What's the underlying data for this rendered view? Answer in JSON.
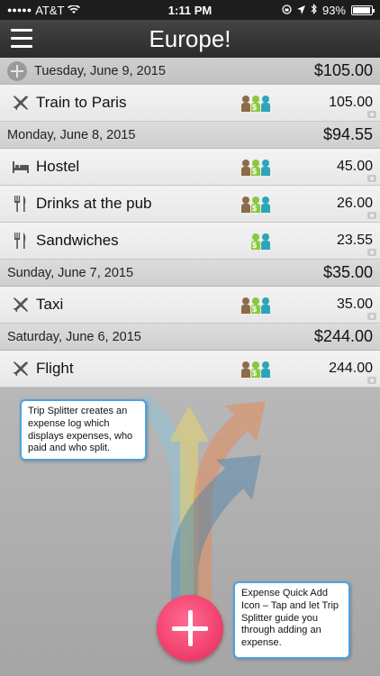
{
  "status": {
    "carrier": "AT&T",
    "time": "1:11 PM",
    "battery": "93%",
    "battery_level": 0.93
  },
  "nav": {
    "title": "Europe!"
  },
  "days": [
    {
      "date": "Tuesday, June 9, 2015",
      "total": "$105.00",
      "expenses": [
        {
          "name": "Train to Paris",
          "amount": "105.00",
          "icon": "airplane-icon"
        }
      ]
    },
    {
      "date": "Monday, June 8, 2015",
      "total": "$94.55",
      "expenses": [
        {
          "name": "Hostel",
          "amount": "45.00",
          "icon": "bed-icon"
        },
        {
          "name": "Drinks at the pub",
          "amount": "26.00",
          "icon": "fork-knife-icon"
        },
        {
          "name": "Sandwiches",
          "amount": "23.55",
          "icon": "fork-knife-icon"
        }
      ]
    },
    {
      "date": "Sunday, June 7, 2015",
      "total": "$35.00",
      "expenses": [
        {
          "name": "Taxi",
          "amount": "35.00",
          "icon": "airplane-icon"
        }
      ]
    },
    {
      "date": "Saturday, June 6, 2015",
      "total": "$244.00",
      "expenses": [
        {
          "name": "Flight",
          "amount": "244.00",
          "icon": "airplane-icon"
        }
      ]
    }
  ],
  "callouts": {
    "log": "Trip Splitter creates an expense log which displays expenses, who paid and who split.",
    "quick_add": "Expense Quick Add Icon – Tap and let Trip Splitter guide you through adding an expense."
  },
  "colors": {
    "person_brown": "#8b6b4a",
    "person_green": "#8cc63f",
    "person_teal": "#2aa6b8",
    "accent_pink": "#f2426f",
    "callout_border": "#4aa3e0"
  }
}
